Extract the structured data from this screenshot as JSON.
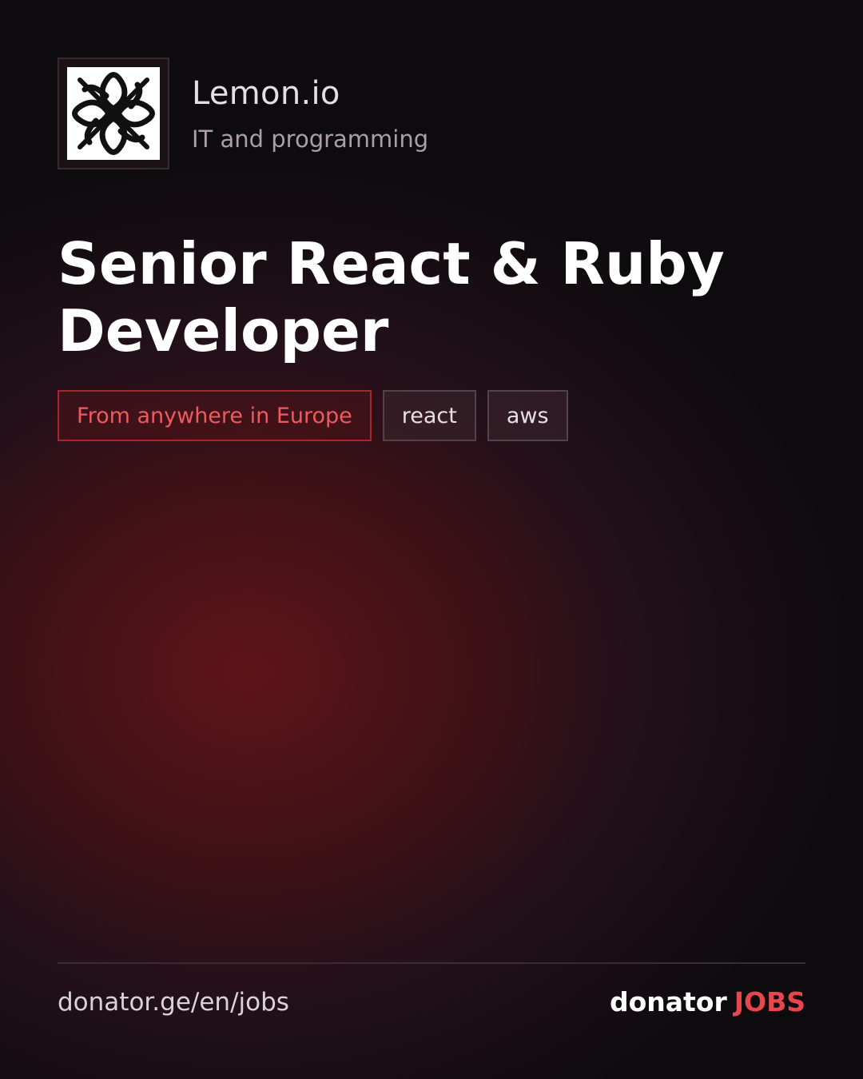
{
  "company": {
    "logo_icon": "celtic-knot-icon",
    "name": "Lemon.io",
    "category": "IT and programming"
  },
  "job": {
    "title": "Senior React & Ruby Developer",
    "tags": [
      {
        "label": "From anywhere in Europe",
        "kind": "location"
      },
      {
        "label": "react",
        "kind": "skill"
      },
      {
        "label": "aws",
        "kind": "skill"
      }
    ]
  },
  "footer": {
    "url": "donator.ge/en/jobs",
    "brand_primary": "donator",
    "brand_accent": "JOBS"
  },
  "colors": {
    "accent": "#e7474c",
    "background": "#0e0b0e",
    "glow": "#5e1518"
  }
}
